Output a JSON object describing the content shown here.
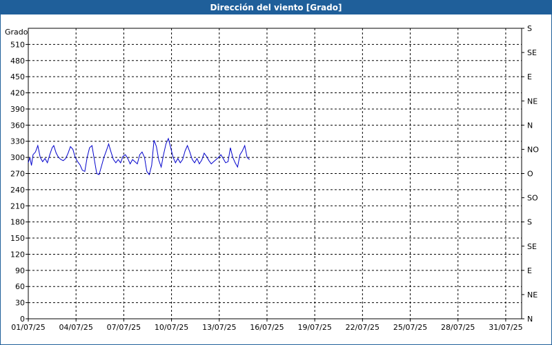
{
  "window": {
    "title": "Dirección del viento [Grado]"
  },
  "chart_data": {
    "type": "line",
    "title": "Dirección del viento [Grado]",
    "ylabel": "Grado",
    "xlabel": "",
    "ylim": [
      0,
      540
    ],
    "y_ticks": [
      0,
      30,
      60,
      90,
      120,
      150,
      180,
      210,
      240,
      270,
      300,
      330,
      360,
      390,
      420,
      450,
      480,
      510
    ],
    "y2_ticks": [
      "N",
      "NE",
      "E",
      "SE",
      "S",
      "SO",
      "O",
      "NO",
      "N",
      "NE",
      "E",
      "SE",
      "S"
    ],
    "x_ticks": [
      "01/07/25",
      "04/07/25",
      "07/07/25",
      "10/07/25",
      "13/07/25",
      "16/07/25",
      "19/07/25",
      "22/07/25",
      "25/07/25",
      "28/07/25",
      "31/07/25"
    ],
    "x_range_days": [
      0,
      31
    ],
    "grid": true,
    "series": [
      {
        "color": "#0000cc",
        "x": [
          0.0,
          0.1,
          0.2,
          0.3,
          0.45,
          0.6,
          0.75,
          0.9,
          1.05,
          1.2,
          1.35,
          1.5,
          1.6,
          1.75,
          1.9,
          2.05,
          2.2,
          2.35,
          2.5,
          2.65,
          2.8,
          2.95,
          3.1,
          3.25,
          3.4,
          3.55,
          3.7,
          3.85,
          4.0,
          4.15,
          4.3,
          4.45,
          4.6,
          4.75,
          4.9,
          5.05,
          5.2,
          5.35,
          5.5,
          5.65,
          5.8,
          5.95,
          6.1,
          6.25,
          6.4,
          6.55,
          6.7,
          6.85,
          7.0,
          7.15,
          7.3,
          7.45,
          7.6,
          7.75,
          7.9,
          8.05,
          8.2,
          8.35,
          8.5,
          8.65,
          8.8,
          8.95,
          9.1,
          9.25,
          9.4,
          9.55,
          9.7,
          9.85,
          10.0,
          10.15,
          10.3,
          10.45,
          10.6,
          10.75,
          10.9,
          11.05,
          11.2,
          11.35,
          11.5,
          11.65,
          11.8,
          11.95,
          12.1,
          12.25,
          12.4,
          12.55,
          12.7,
          12.85,
          13.0,
          13.15,
          13.3,
          13.45,
          13.6,
          13.75,
          13.9
        ],
        "y": [
          290,
          300,
          285,
          305,
          310,
          322,
          300,
          292,
          298,
          290,
          305,
          318,
          322,
          308,
          300,
          296,
          294,
          298,
          308,
          320,
          315,
          300,
          292,
          286,
          276,
          274,
          300,
          318,
          322,
          296,
          270,
          268,
          284,
          300,
          312,
          325,
          310,
          296,
          290,
          296,
          290,
          302,
          305,
          298,
          288,
          296,
          292,
          288,
          305,
          310,
          300,
          274,
          268,
          285,
          332,
          320,
          295,
          282,
          305,
          325,
          335,
          318,
          300,
          290,
          298,
          290,
          296,
          312,
          322,
          310,
          296,
          290,
          298,
          288,
          295,
          308,
          302,
          294,
          288,
          292,
          296,
          300,
          305,
          298,
          290,
          292,
          318,
          300,
          290,
          282,
          305,
          312,
          322,
          300,
          296
        ]
      }
    ]
  }
}
